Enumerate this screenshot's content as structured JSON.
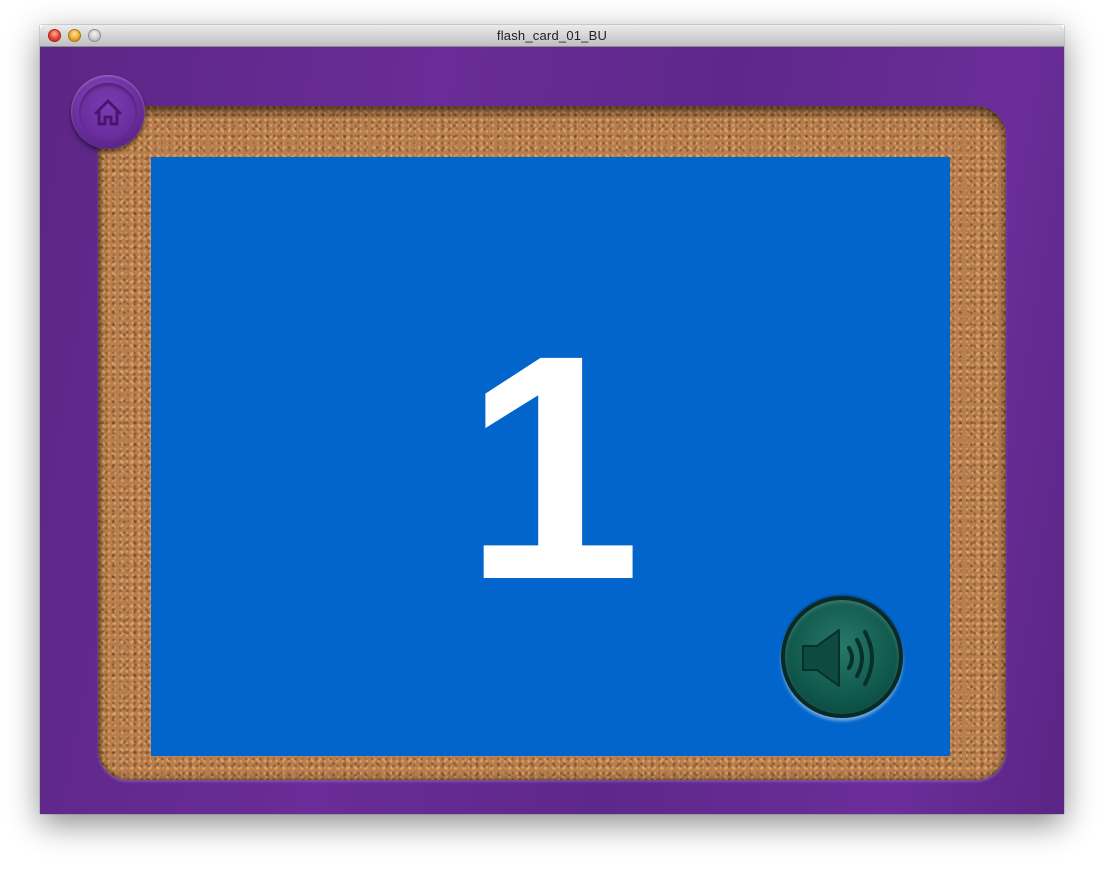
{
  "window": {
    "title": "flash_card_01_BU"
  },
  "card": {
    "value": "1",
    "background_color": "#0265cb",
    "text_color": "#ffffff"
  },
  "theme": {
    "frame_color": "#6a2c98",
    "cork_color": "#b97e4b",
    "sound_button_color": "#10584c"
  },
  "icons": {
    "home": "home-icon",
    "sound": "speaker-icon"
  }
}
